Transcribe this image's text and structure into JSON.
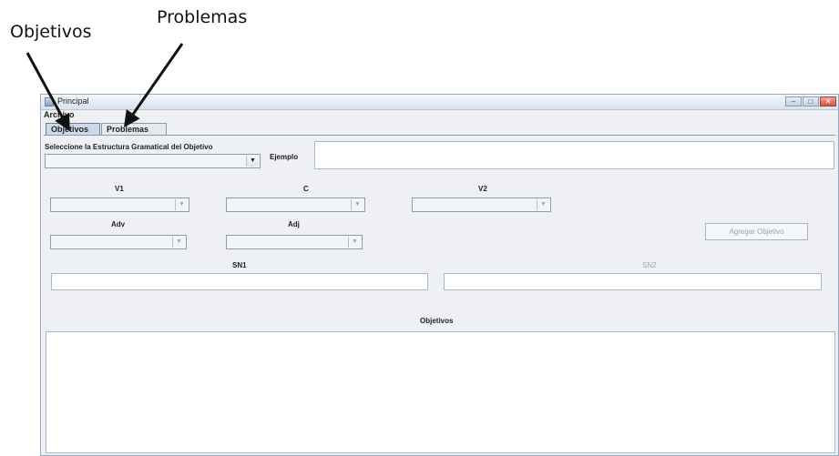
{
  "annotations": {
    "objetivos": "Objetivos",
    "problemas": "Problemas"
  },
  "window": {
    "title": "Principal",
    "controls": [
      "minimize-icon",
      "maximize-icon",
      "close-icon"
    ]
  },
  "menu": {
    "archivo": "Archivo"
  },
  "tabs": [
    "Objetivos",
    "Problemas"
  ],
  "form": {
    "estructura_label": "Seleccione la Estructura Gramatical del Objetivo",
    "ejemplo_label": "Ejemplo",
    "v1": "V1",
    "c": "C",
    "v2": "V2",
    "adv": "Adv",
    "adj": "Adj",
    "agregar": "Agregar Objetivo",
    "sn1": "SN1",
    "sn2": "SN2",
    "objetivos": "Objetivos"
  }
}
